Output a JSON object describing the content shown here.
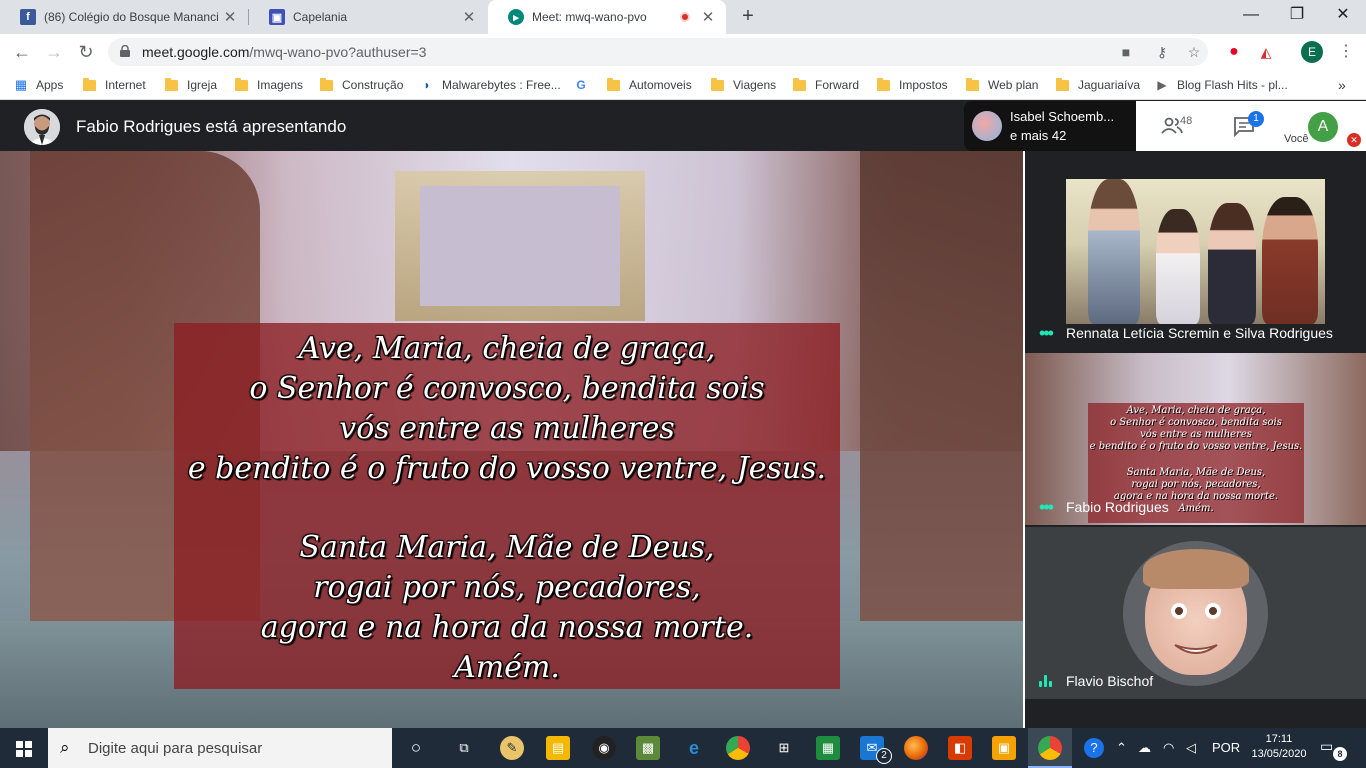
{
  "browser": {
    "tabs": [
      {
        "title": "(86) Colégio do Bosque Mananci",
        "favicon": "facebook-icon",
        "color": "#3b5998"
      },
      {
        "title": "Capelania",
        "favicon": "site-icon",
        "color": "#3f51b5"
      },
      {
        "title": "Meet: mwq-wano-pvo",
        "favicon": "meet-icon",
        "color": "#00897b"
      }
    ],
    "url_host": "meet.google.com",
    "url_path": "/mwq-wano-pvo?authuser=3",
    "profile_initial": "E"
  },
  "bookmarks": [
    {
      "label": "Apps",
      "icon": "apps-icon"
    },
    {
      "label": "Internet",
      "icon": "folder-icon"
    },
    {
      "label": "Igreja",
      "icon": "folder-icon"
    },
    {
      "label": "Imagens",
      "icon": "folder-icon"
    },
    {
      "label": "Construção",
      "icon": "folder-icon"
    },
    {
      "label": "Malwarebytes : Free...",
      "icon": "malwarebytes-icon"
    },
    {
      "label": "",
      "icon": "google-icon"
    },
    {
      "label": "Automoveis",
      "icon": "folder-icon"
    },
    {
      "label": "Viagens",
      "icon": "folder-icon"
    },
    {
      "label": "Forward",
      "icon": "folder-icon"
    },
    {
      "label": "Impostos",
      "icon": "folder-icon"
    },
    {
      "label": "Web plan",
      "icon": "folder-icon"
    },
    {
      "label": "Jaguariaíva",
      "icon": "folder-icon"
    },
    {
      "label": "Blog Flash Hits - pl...",
      "icon": "play-icon"
    },
    {
      "label": "»",
      "icon": "more-bookmarks-icon"
    }
  ],
  "meet": {
    "presenting_title": "Fabio Rodrigues está apresentando",
    "others_name": "Isabel Schoemb...",
    "others_more": "e mais 42",
    "people_count": "48",
    "chat_badge": "1",
    "you_initial": "A",
    "you_label": "Você"
  },
  "slide": {
    "lines": [
      "Ave, Maria, cheia de graça,",
      "o Senhor é convosco, bendita sois",
      "vós entre as mulheres",
      "e bendito é o fruto do vosso ventre, Jesus.",
      "Santa Maria, Mãe de Deus,",
      "rogai por nós, pecadores,",
      "agora e na hora da nossa morte.",
      "Amém."
    ]
  },
  "participants": [
    {
      "name": "Rennata Letícia Scremin e Silva Rodrigues",
      "indicator": "dots"
    },
    {
      "name": "Fabio Rodrigues",
      "indicator": "dots"
    },
    {
      "name": "Flavio Bischof",
      "indicator": "speaking"
    }
  ],
  "taskbar": {
    "search_placeholder": "Digite aqui para pesquisar",
    "language": "POR",
    "time": "17:11",
    "date": "13/05/2020",
    "notifications": "8",
    "mail_badge": "2"
  }
}
